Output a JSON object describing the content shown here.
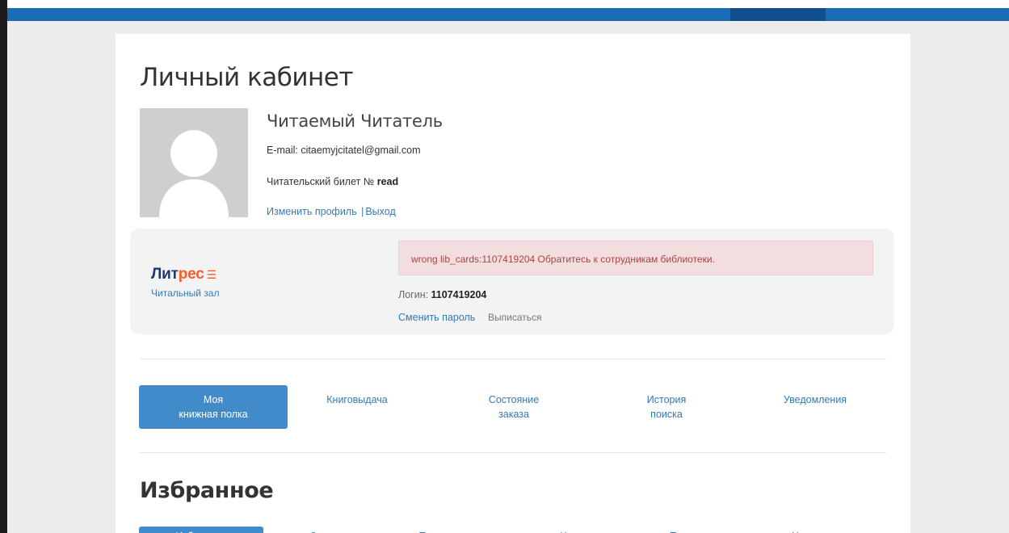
{
  "colors": {
    "topbar": "#1d6bb4",
    "topbar_active": "#114f8c",
    "link": "#337ab7",
    "tab_active_bg": "#428bca",
    "alert_bg": "#f2dede",
    "alert_text": "#a94442",
    "litres_orange": "#ff5a1f",
    "litres_navy": "#1f3a6e"
  },
  "page": {
    "title": "Личный кабинет"
  },
  "user": {
    "avatar_icon": "user-silhouette-icon",
    "name": "Читаемый Читатель",
    "email": "E-mail: citaemyjcitatel@gmail.com",
    "ticket_label": "Читательский билет № ",
    "ticket_value": "read",
    "edit_profile": "Изменить профиль",
    "separator": "|",
    "logout": "Выход"
  },
  "litres": {
    "logo_part1": "Лит",
    "logo_part2": "рес",
    "logo_icon": "litres-lines-icon",
    "reading_room": "Читальный зал",
    "alert": "wrong lib_cards:1107419204 Обратитесь к сотрудникам библиотеки.",
    "login_label": "Логин: ",
    "login_value": "1107419204",
    "change_password": "Сменить пароль",
    "unsubscribe": "Выписаться"
  },
  "tabs": [
    {
      "label": "Моя\nкнижная полка",
      "active": true
    },
    {
      "label": "Книговыдача",
      "active": false
    },
    {
      "label": "Состояние\nзаказа",
      "active": false
    },
    {
      "label": "История\nпоиска",
      "active": false
    },
    {
      "label": "Уведомления",
      "active": false
    }
  ],
  "favorites": {
    "title": "Избранное",
    "subtabs": [
      {
        "label": "Избранное",
        "active": true
      },
      {
        "label": "Заказы",
        "active": false
      },
      {
        "label": "Прочту позже",
        "active": false
      },
      {
        "label": "Читаю",
        "active": false
      },
      {
        "label": "Прочитано",
        "active": false
      },
      {
        "label": "Не интересно",
        "active": false
      }
    ]
  }
}
